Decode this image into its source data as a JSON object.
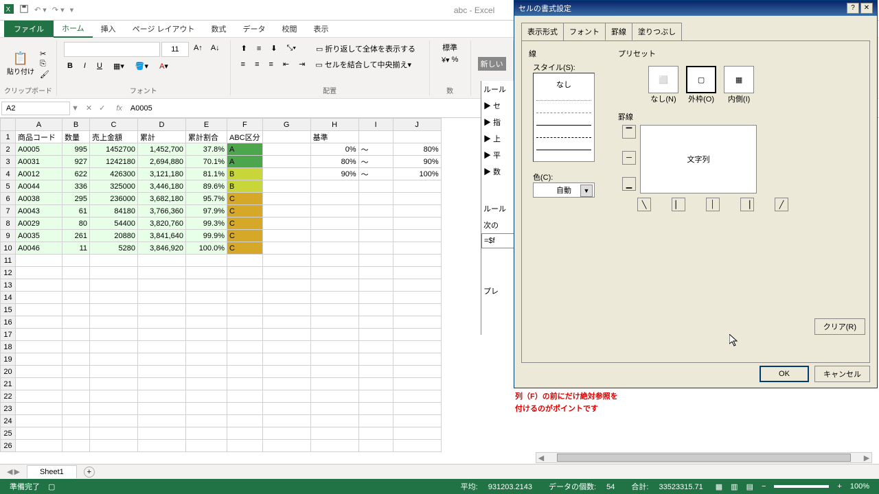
{
  "app": {
    "title": "abc - Excel"
  },
  "qat": {
    "save": "保存",
    "undo": "元に戻す",
    "redo": "やり直し"
  },
  "ribbon": {
    "tabs": {
      "file": "ファイル",
      "home": "ホーム",
      "insert": "挿入",
      "pagelayout": "ページ レイアウト",
      "formulas": "数式",
      "data": "データ",
      "review": "校閲",
      "view": "表示"
    },
    "groups": {
      "clipboard": "クリップボード",
      "font": "フォント",
      "alignment": "配置",
      "number": "数"
    },
    "font_size": "11",
    "wrap": "折り返して全体を表示する",
    "merge": "セルを結合して中央揃え",
    "number_format": "標準",
    "new_rule": "新しい"
  },
  "namebox": "A2",
  "formula": "A0005",
  "cols": [
    "A",
    "B",
    "C",
    "D",
    "E",
    "F",
    "G",
    "H",
    "I",
    "J"
  ],
  "headers": [
    "商品コード",
    "数量",
    "売上金額",
    "累計",
    "累計割合",
    "ABC区分",
    "",
    "基準",
    "",
    ""
  ],
  "rows": [
    {
      "n": 2,
      "a": "A0005",
      "b": "995",
      "c": "1452700",
      "d": "1,452,700",
      "e": "37.8%",
      "f": "A",
      "g": "",
      "h": "0%",
      "i": "～",
      "j": "80%",
      "grade": "a"
    },
    {
      "n": 3,
      "a": "A0031",
      "b": "927",
      "c": "1242180",
      "d": "2,694,880",
      "e": "70.1%",
      "f": "A",
      "g": "",
      "h": "80%",
      "i": "～",
      "j": "90%",
      "grade": "a"
    },
    {
      "n": 4,
      "a": "A0012",
      "b": "622",
      "c": "426300",
      "d": "3,121,180",
      "e": "81.1%",
      "f": "B",
      "g": "",
      "h": "90%",
      "i": "～",
      "j": "100%",
      "grade": "b"
    },
    {
      "n": 5,
      "a": "A0044",
      "b": "336",
      "c": "325000",
      "d": "3,446,180",
      "e": "89.6%",
      "f": "B",
      "g": "",
      "h": "",
      "i": "",
      "j": "",
      "grade": "b"
    },
    {
      "n": 6,
      "a": "A0038",
      "b": "295",
      "c": "236000",
      "d": "3,682,180",
      "e": "95.7%",
      "f": "C",
      "g": "",
      "h": "",
      "i": "",
      "j": "",
      "grade": "c"
    },
    {
      "n": 7,
      "a": "A0043",
      "b": "61",
      "c": "84180",
      "d": "3,766,360",
      "e": "97.9%",
      "f": "C",
      "g": "",
      "h": "",
      "i": "",
      "j": "",
      "grade": "c"
    },
    {
      "n": 8,
      "a": "A0029",
      "b": "80",
      "c": "54400",
      "d": "3,820,760",
      "e": "99.3%",
      "f": "C",
      "g": "",
      "h": "",
      "i": "",
      "j": "",
      "grade": "c"
    },
    {
      "n": 9,
      "a": "A0035",
      "b": "261",
      "c": "20880",
      "d": "3,841,640",
      "e": "99.9%",
      "f": "C",
      "g": "",
      "h": "",
      "i": "",
      "j": "",
      "grade": "c"
    },
    {
      "n": 10,
      "a": "A0046",
      "b": "11",
      "c": "5280",
      "d": "3,846,920",
      "e": "100.0%",
      "f": "C",
      "g": "",
      "h": "",
      "i": "",
      "j": "",
      "grade": "c"
    }
  ],
  "empty_rows": [
    11,
    12,
    13,
    14,
    15,
    16,
    17,
    18,
    19,
    20,
    21,
    22,
    23,
    24,
    25,
    26
  ],
  "sheet_tab": "Sheet1",
  "status": {
    "ready": "準備完了",
    "avg_lbl": "平均:",
    "avg": "931203.2143",
    "cnt_lbl": "データの個数:",
    "cnt": "54",
    "sum_lbl": "合計:",
    "sum": "33523315.71",
    "zoom": "100%"
  },
  "partial": {
    "title": "ルール",
    "items": [
      "▶ セ",
      "▶ 指",
      "▶ 上",
      "▶ 平",
      "▶ 数"
    ],
    "rule": "ルール",
    "next": "次の",
    "formula": "=$f",
    "preview": "プレ"
  },
  "dialog": {
    "title": "セルの書式設定",
    "tabs": {
      "number": "表示形式",
      "font": "フォント",
      "border": "罫線",
      "fill": "塗りつぶし"
    },
    "line": "線",
    "style": "スタイル(S):",
    "none": "なし",
    "color": "色(C):",
    "auto": "自動",
    "preset": "プリセット",
    "preset_none": "なし(N)",
    "preset_outline": "外枠(O)",
    "preset_inside": "内側(I)",
    "border": "罫線",
    "preview_text": "文字列",
    "clear": "クリア(R)",
    "ok": "OK",
    "cancel": "キャンセル"
  },
  "annotation": {
    "l1": "列（F）の前にだけ絶対参照を",
    "l2": "付けるのがポイントです"
  }
}
